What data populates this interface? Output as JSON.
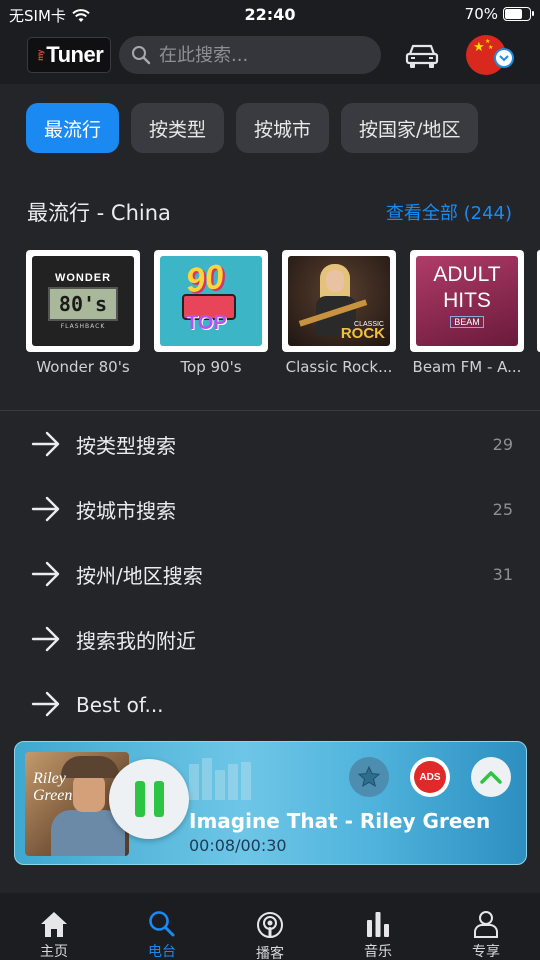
{
  "status_bar": {
    "carrier": "无SIM卡",
    "time": "22:40",
    "battery": "70%",
    "battery_level": 0.7
  },
  "header": {
    "logo_text": "Tuner",
    "logo_prefix": "my",
    "search_placeholder": "在此搜索..."
  },
  "tabs": [
    {
      "label": "最流行",
      "active": true
    },
    {
      "label": "按类型",
      "active": false
    },
    {
      "label": "按城市",
      "active": false
    },
    {
      "label": "按国家/地区",
      "active": false
    }
  ],
  "section": {
    "title": "最流行 - China",
    "see_all": "查看全部 (244)"
  },
  "stations": [
    {
      "name": "Wonder 80's",
      "art": {
        "top": "WONDER",
        "screen": "80's",
        "bottom": "FLASHBACK"
      }
    },
    {
      "name": "Top 90's",
      "art": {
        "top": "90",
        "bottom": "TOP"
      }
    },
    {
      "name": "Classic Rock...",
      "art": {
        "top": "CLASSIC",
        "bottom": "ROCK"
      }
    },
    {
      "name": "Beam FM - A...",
      "art": {
        "top": "ADULT",
        "middle": "HITS",
        "bottom": "BEAM"
      }
    }
  ],
  "browse": [
    {
      "label": "按类型搜索",
      "count": "29"
    },
    {
      "label": "按城市搜索",
      "count": "25"
    },
    {
      "label": "按州/地区搜索",
      "count": "31"
    },
    {
      "label": "搜索我的附近",
      "count": ""
    },
    {
      "label": "Best of...",
      "count": ""
    }
  ],
  "player": {
    "track": "Imagine That - Riley Green",
    "time": "00:08/00:30",
    "cover_text": [
      "Riley",
      "Green"
    ],
    "ads_label": "ADS"
  },
  "nav": [
    {
      "label": "主页",
      "icon": "home-icon",
      "active": false
    },
    {
      "label": "电台",
      "icon": "search-icon",
      "active": true
    },
    {
      "label": "播客",
      "icon": "podcast-icon",
      "active": false
    },
    {
      "label": "音乐",
      "icon": "music-bars-icon",
      "active": false
    },
    {
      "label": "专享",
      "icon": "user-icon",
      "active": false
    }
  ],
  "colors": {
    "accent": "#1a8af2",
    "background": "#242529",
    "play_green": "#2ec443",
    "ads_red": "#e02a2a"
  }
}
